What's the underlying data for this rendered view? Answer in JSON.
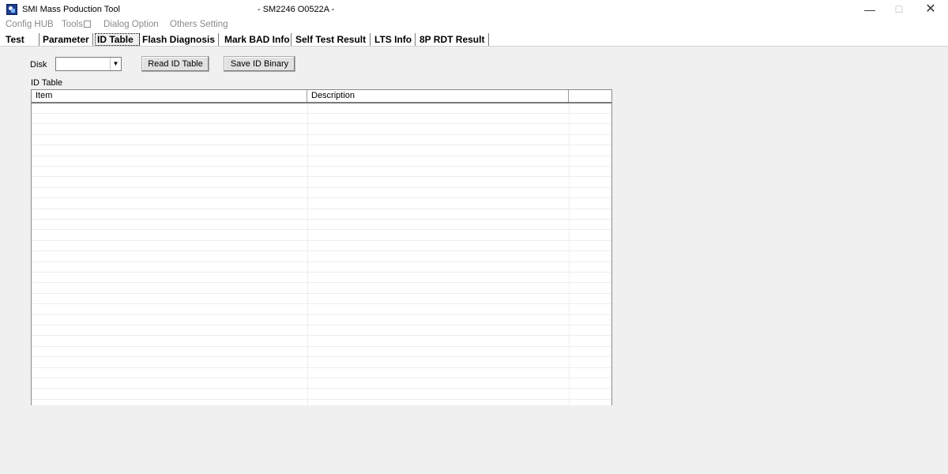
{
  "window": {
    "title": "SMI Mass Poduction Tool",
    "subtitle": "- SM2246 O0522A -",
    "minimize": "—",
    "maximize": "☐",
    "close": "✕",
    "icon": "app-icon"
  },
  "menu": {
    "config_hub": "Config HUB",
    "tools": "Tools",
    "dialog_option": "Dialog Option",
    "others_setting": "Others Setting"
  },
  "tabs": {
    "test": "Test",
    "parameter": "Parameter",
    "id_table": "ID Table",
    "flash_diagnosis": "Flash Diagnosis",
    "mark_bad_info": "Mark BAD Info",
    "self_test_result": "Self Test Result",
    "lts_info": "LTS Info",
    "rdt_result": "8P RDT Result",
    "active": "ID Table"
  },
  "form": {
    "disk_label": "Disk",
    "disk_value": "",
    "read_button": "Read ID Table",
    "save_button": "Save ID Binary",
    "table_label": "ID Table"
  },
  "table": {
    "columns": [
      "Item",
      "Description",
      ""
    ],
    "rows": []
  }
}
